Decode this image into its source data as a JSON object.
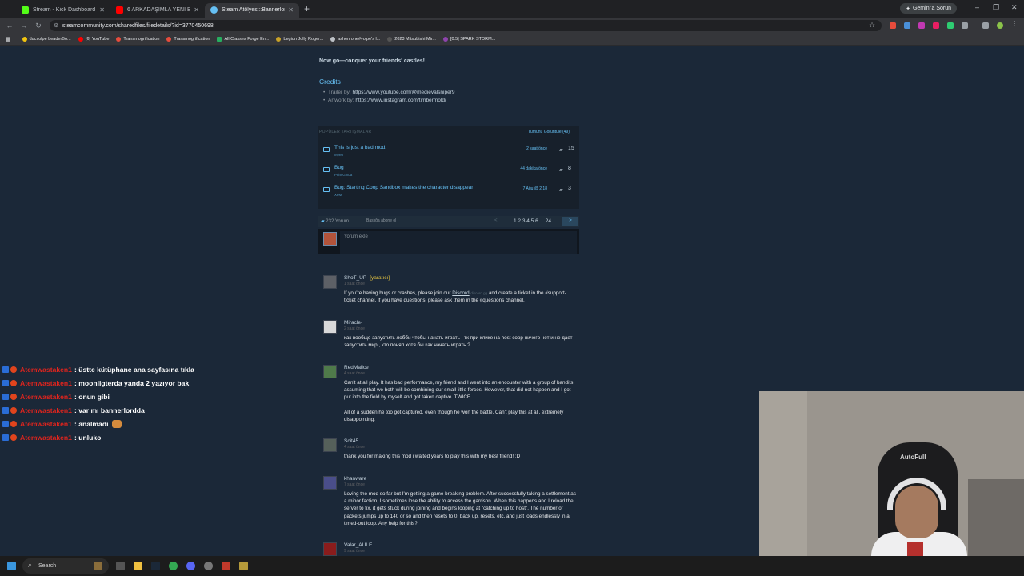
{
  "browser": {
    "tabs": [
      {
        "title": "Stream - Kick Dashboard",
        "color": "#53fc18"
      },
      {
        "title": "6 ARKADAŞIMLA YENİ BANNER",
        "color": "#ff0000"
      },
      {
        "title": "Steam Atölyesi::Bannerlord Co",
        "color": "#66c0f4"
      }
    ],
    "gemini_label": "Gemini'a Sorun",
    "url": "steamcommunity.com/sharedfiles/filedetails/?id=3770450698",
    "bookmarks": [
      "ducvolpe LeaderBo...",
      "(6) YouTube",
      "Transmogrification",
      "Transmogrification",
      "All Classes Forge En...",
      "Legion Jolly Roger...",
      "ashen one#volpe's l...",
      "2023 Mitsubishi Mir...",
      "[0.5] SPARK STORM..."
    ]
  },
  "page": {
    "conquer": "Now go—conquer your friends' castles!",
    "credits_title": "Credits",
    "credits": [
      {
        "label": "Trailer by: ",
        "value": "https://www.youtube.com/@medievalsniper9"
      },
      {
        "label": "Artwork by: ",
        "value": "https://www.instagram.com/timbermold/"
      }
    ],
    "discussions": {
      "header": "POPÜLER TARTIŞMALAR",
      "view_all": "Tümünü Görüntüle (49)",
      "threads": [
        {
          "title": "This is just a bad mod.",
          "author": "Myen",
          "time": "2 saat önce",
          "count": "15"
        },
        {
          "title": "Bug",
          "author": "PrincGinda",
          "time": "44 dakika önce",
          "count": "8"
        },
        {
          "title": "Bug: Starting Coop Sandbox makes the character disappear",
          "author": "XeM",
          "time": "7 Ağu @ 2:18",
          "count": "3"
        }
      ]
    },
    "comments_bar": {
      "count": "232 Yorum",
      "subscribe": "Başlığa abone ol",
      "pages": "1 2 3 4 5 6 ... 24",
      "next": ">"
    },
    "add_comment": "Yorum ekle",
    "comments": [
      {
        "name": "ShoT_UP",
        "creator": "[yaratıcı]",
        "time": "1 saat önce",
        "text_a": "If you're having bugs or crashes, please join our ",
        "link": "Discord",
        "gray": "discord.gg",
        "text_b": " and create a ticket in the #support-ticket channel. If you have questions, please ask them in the #questions channel.",
        "avatar": "#5d6066"
      },
      {
        "name": "Miracle-",
        "time": "2 saat önce",
        "text": "как вообще запустить лобби чтобы начать играть , тк при клике на host coop ничего нет и не дает запустить мир , кто понял хотя бы как начать играть ?",
        "avatar": "#d9d9d9"
      },
      {
        "name": "RedMalice",
        "time": "4 saat önce",
        "text": "Can't at all play. It has bad performance, my friend and I went into an encounter with a group of bandits assuming that we both will be combining our small little forces. However, that did not happen and I got put into the field by myself and got taken captive. TWICE.",
        "text2": "All of a sudden he too got captured, even though he won the battle. Can't play this at all, extremely disappointing.",
        "avatar": "#4f7a4a"
      },
      {
        "name": "Scit45",
        "time": "4 saat önce",
        "text": "thank you for making this mod i waited years to play this with my best friend! :D",
        "avatar": "#55605a"
      },
      {
        "name": "khanware",
        "time": "7 saat önce",
        "text": "Loving the mod so far but I'm getting a game breaking problem. After successfully taking a settlement as a minor faction, I sometimes lose the ability to access the garrison. When this happens and I reload the server to fix, it gets stuck during joining and begins looping at \"catching up to host\". The number of packets jumps up to 140 or so and then resets to 0, back up, resets, etc, and just loads endlessly in a timed-out loop. Any help for this?",
        "avatar": "#4a4e8a"
      },
      {
        "name": "Valar_AULE",
        "time": "9 saat önce",
        "avatar": "#8a1c1c"
      }
    ]
  },
  "chat": {
    "user": "Atemwastaken1",
    "messages": [
      ": üstte kütüphane ana sayfasına tıkla",
      ": moonligterda yanda 2 yazıyor bak",
      ": onun gibi",
      ": var mı bannerlordda",
      ": analmadı",
      ": unluko"
    ]
  },
  "webcam": {
    "chair_logo": "AutoFull"
  },
  "taskbar": {
    "search": "Search"
  }
}
